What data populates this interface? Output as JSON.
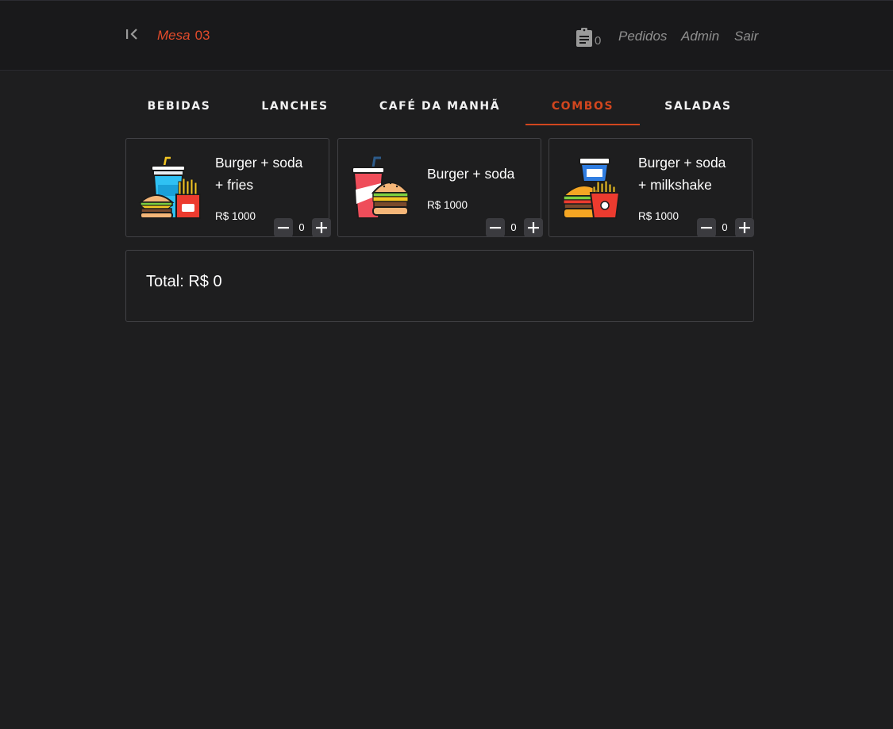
{
  "header": {
    "table_word": "Mesa",
    "table_number": "03",
    "orders_count": "0",
    "links": [
      "Pedidos",
      "Admin",
      "Sair"
    ]
  },
  "icons": {
    "back": "chevrons-left-to-bar-icon",
    "orders": "clipboard-list-icon",
    "minus": "minus-icon",
    "plus": "plus-icon"
  },
  "tabs": [
    "BEBIDAS",
    "LANCHES",
    "CAFÉ DA MANHÃ",
    "COMBOS",
    "SALADAS"
  ],
  "active_tab": "COMBOS",
  "products": [
    {
      "name_lines": [
        "Burger + soda",
        "+ fries"
      ],
      "price": "R$ 1000",
      "qty": "0",
      "image": "burger-soda-fries-illustration"
    },
    {
      "name_lines": [
        "Burger + soda"
      ],
      "price": "R$ 1000",
      "qty": "0",
      "image": "soda-burger-illustration"
    },
    {
      "name_lines": [
        "Burger + soda",
        "+ milkshake"
      ],
      "price": "R$ 1000",
      "qty": "0",
      "image": "milkshake-burger-fries-illustration"
    }
  ],
  "total_label": "Total: R$ 0",
  "colors": {
    "accent": "#d2461e",
    "table_label": "#e34b2b",
    "background": "#1e1e1f",
    "header_background": "#19191b"
  }
}
